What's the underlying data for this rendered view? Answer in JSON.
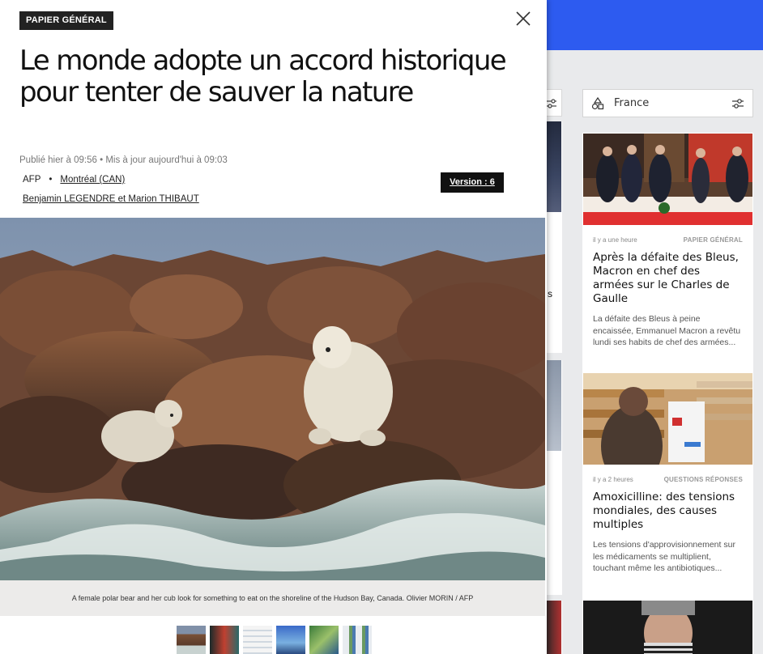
{
  "article": {
    "badge": "PAPIER GÉNÉRAL",
    "title": "Le monde adopte un accord historique pour tenter de sauver la nature",
    "published": "Publié hier à 09:56 • Mis à jour aujourd'hui à 09:03",
    "source": "AFP",
    "separator": "•",
    "location": "Montréal (CAN)",
    "version": "Version : 6",
    "authors": "Benjamin LEGENDRE et Marion THIBAUT",
    "caption": "A female polar bear and her cub look for something to eat on the shoreline of the Hudson Bay, Canada. Olivier MORIN / AFP",
    "gallery_count": 6
  },
  "column": {
    "title": "France",
    "cards": [
      {
        "time": "il y a une heure",
        "category": "PAPIER GÉNÉRAL",
        "title": "Après la défaite des Bleus, Macron en chef des armées sur le Charles de Gaulle",
        "description": "La défaite des Bleus à peine encaissée, Emmanuel Macron a revêtu lundi ses habits de chef des armées..."
      },
      {
        "time": "il y a 2 heures",
        "category": "QUESTIONS RÉPONSES",
        "title": "Amoxicilline: des tensions mondiales, des causes multiples",
        "description": "Les tensions d'approvisionnement sur les médicaments se multiplient, touchant même les antibiotiques..."
      }
    ]
  },
  "colors": {
    "accent": "#2d5bf0",
    "badge_bg": "#222222"
  }
}
